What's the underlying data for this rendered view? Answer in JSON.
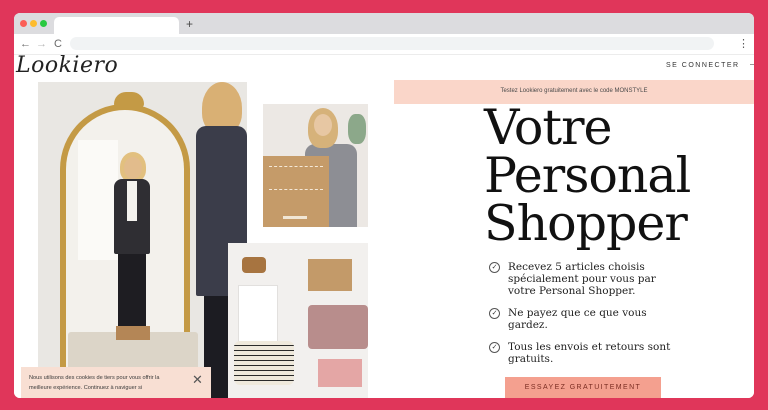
{
  "browser": {
    "new_tab_symbol": "+",
    "back_symbol": "←",
    "forward_symbol": "→",
    "reload_symbol": "C",
    "menu_symbol": "⋮"
  },
  "header": {
    "logo": "Lookiero",
    "login_label": "SE CONNECTER"
  },
  "promo_banner": {
    "text": "Testez Lookiero gratuitement avec le code MONSTYLE"
  },
  "hero": {
    "headline_lines": [
      "Votre",
      "Personal",
      "Shopper"
    ],
    "benefits": [
      {
        "icon": "check-circle-icon",
        "text": "Recevez 5 articles choisis spécialement pour vous par votre Personal Shopper."
      },
      {
        "icon": "check-circle-icon",
        "text": "Ne payez que ce que vous gardez."
      },
      {
        "icon": "check-circle-icon",
        "text": "Tous les envois et retours sont gratuits."
      }
    ],
    "cta_label": "ESSAYEZ GRATUITEMENT"
  },
  "cookie_notice": {
    "text": "Nous utilisons des cookies de tiers pour vous offrir la meilleure expérience. Continuez à naviguer si",
    "close_symbol": "✕"
  },
  "colors": {
    "frame": "#e0365a",
    "banner": "#fad6c9",
    "cta": "#f4a08f",
    "cookie": "#f8dfd3"
  }
}
